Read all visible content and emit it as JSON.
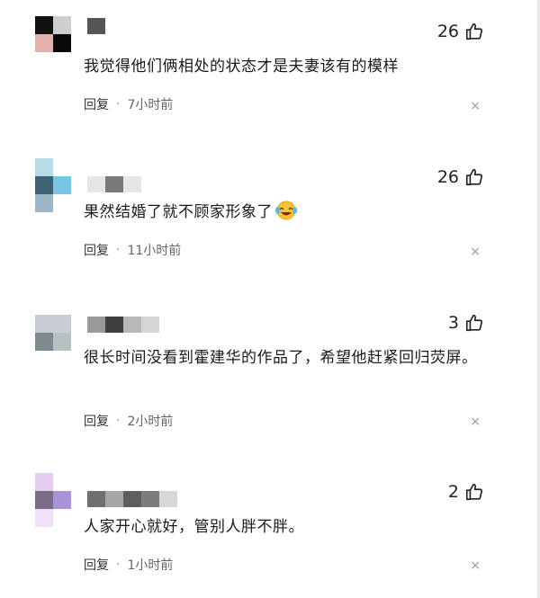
{
  "comments": [
    {
      "text": "我觉得他们俩相处的状态才是夫妻该有的模样",
      "likes": "26",
      "reply_label": "回复",
      "separator": "·",
      "time": "7小时前",
      "close_glyph": "×",
      "avatar_colors": [
        "#111111",
        "#cfcfcf",
        "#e0b2aa",
        "#0a0a0a"
      ],
      "username_colors": [
        "#555555"
      ]
    },
    {
      "text": "果然结婚了就不顾家形象了",
      "likes": "26",
      "reply_label": "回复",
      "separator": "·",
      "time": "11小时前",
      "close_glyph": "×",
      "avatar_colors": [
        "#b7dbe9",
        "#ffffff",
        "#3e6276",
        "#79c4e0",
        "#9db5c4"
      ],
      "username_colors": [
        "#e6e6e6",
        "#7a7a7a",
        "#e6e6e6"
      ]
    },
    {
      "text": "很长时间没看到霍建华的作品了，希望他赶紧回归荧屏。",
      "likes": "3",
      "reply_label": "回复",
      "separator": "·",
      "time": "2小时前",
      "close_glyph": "×",
      "avatar_colors": [
        "#c8ccd3",
        "#c8ccd3",
        "#7f8a8c",
        "#b8c0c2"
      ],
      "username_colors": [
        "#9a9a9a",
        "#3e3e3e",
        "#b8b8b8",
        "#d5d5d5"
      ]
    },
    {
      "text": "人家开心就好，管别人胖不胖。",
      "likes": "2",
      "reply_label": "回复",
      "separator": "·",
      "time": "1小时前",
      "close_glyph": "×",
      "avatar_colors": [
        "#e2ccef",
        "#ffffff",
        "#7b6a8a",
        "#a993d8",
        "#efdff7"
      ],
      "username_colors": [
        "#6f6f6f",
        "#a7a7a7",
        "#5e5e5e",
        "#7c7c7c",
        "#d8d8d8"
      ]
    }
  ]
}
